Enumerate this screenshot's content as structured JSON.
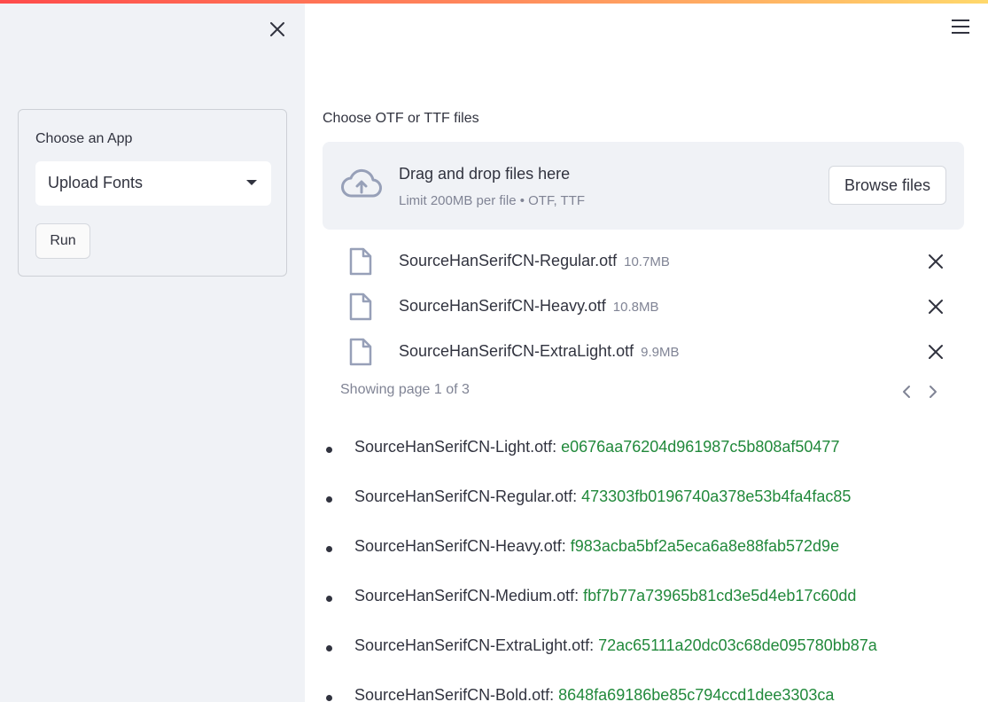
{
  "sidebar": {
    "panel_label": "Choose an App",
    "select_value": "Upload Fonts",
    "run_label": "Run"
  },
  "uploader": {
    "label": "Choose OTF or TTF files",
    "drop_title": "Drag and drop files here",
    "drop_subtitle": "Limit 200MB per file • OTF, TTF",
    "browse_label": "Browse files",
    "files": [
      {
        "name": "SourceHanSerifCN-Regular.otf",
        "size": "10.7MB"
      },
      {
        "name": "SourceHanSerifCN-Heavy.otf",
        "size": "10.8MB"
      },
      {
        "name": "SourceHanSerifCN-ExtraLight.otf",
        "size": "9.9MB"
      }
    ],
    "page_info": "Showing page 1 of 3"
  },
  "hashes": [
    {
      "name": "SourceHanSerifCN-Light.otf:",
      "hash": "e0676aa76204d961987c5b808af50477"
    },
    {
      "name": "SourceHanSerifCN-Regular.otf:",
      "hash": "473303fb0196740a378e53b4fa4fac85"
    },
    {
      "name": "SourceHanSerifCN-Heavy.otf:",
      "hash": "f983acba5bf2a5eca6a8e88fab572d9e"
    },
    {
      "name": "SourceHanSerifCN-Medium.otf:",
      "hash": "fbf7b77a73965b81cd3e5d4eb17c60dd"
    },
    {
      "name": "SourceHanSerifCN-ExtraLight.otf:",
      "hash": "72ac65111a20dc03c68de095780bb87a"
    },
    {
      "name": "SourceHanSerifCN-Bold.otf:",
      "hash": "8648fa69186be85c794ccd1dee3303ca"
    }
  ],
  "icons": {
    "close": "close-icon",
    "menu": "hamburger-menu-icon",
    "upload": "cloud-upload-icon",
    "file": "file-icon",
    "delete": "close-icon",
    "prev": "chevron-left-icon",
    "next": "chevron-right-icon",
    "dropdown": "caret-down-icon"
  },
  "colors": {
    "accent_red": "#ff4b4b",
    "hash_green": "#21893b",
    "sidebar_bg": "#f0f2f6",
    "muted_text": "#808495"
  }
}
